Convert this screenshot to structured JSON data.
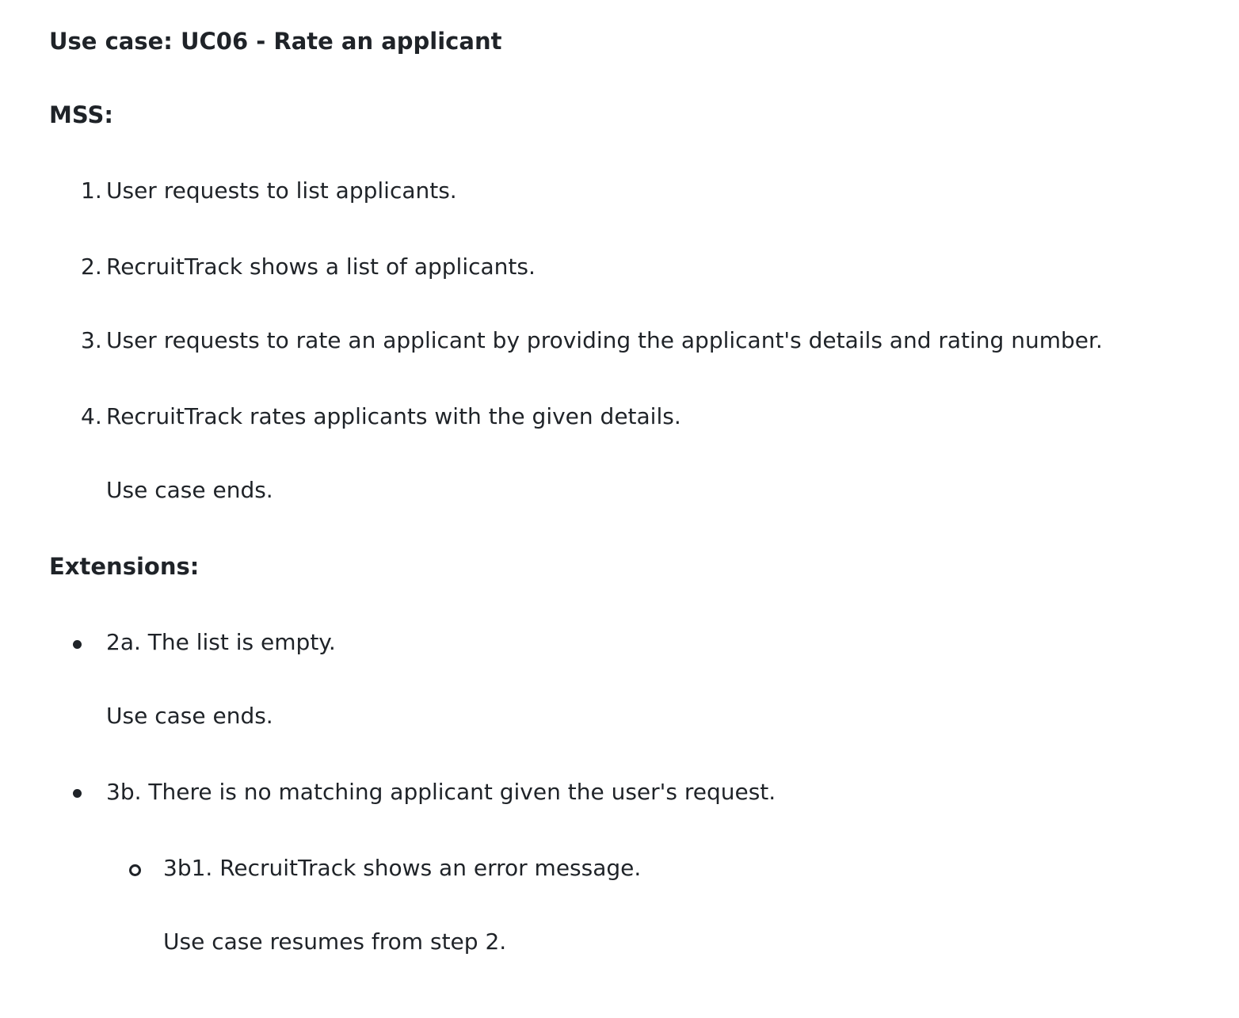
{
  "title": "Use case: UC06 - Rate an applicant",
  "mss": {
    "heading": "MSS:",
    "steps": [
      {
        "number": "1.",
        "text": "User requests to list applicants."
      },
      {
        "number": "2.",
        "text": "RecruitTrack shows a list of applicants."
      },
      {
        "number": "3.",
        "text": "User requests to rate an applicant by providing the applicant's details and rating number."
      },
      {
        "number": "4.",
        "text": "RecruitTrack rates applicants with the given details."
      }
    ],
    "end_note": "Use case ends."
  },
  "extensions": {
    "heading": "Extensions:",
    "items": [
      {
        "text": "2a. The list is empty.",
        "note": "Use case ends."
      },
      {
        "text": "3b. There is no matching applicant given the user's request.",
        "sub": {
          "text": "3b1. RecruitTrack shows an error message.",
          "note": "Use case resumes from step 2."
        }
      }
    ]
  }
}
